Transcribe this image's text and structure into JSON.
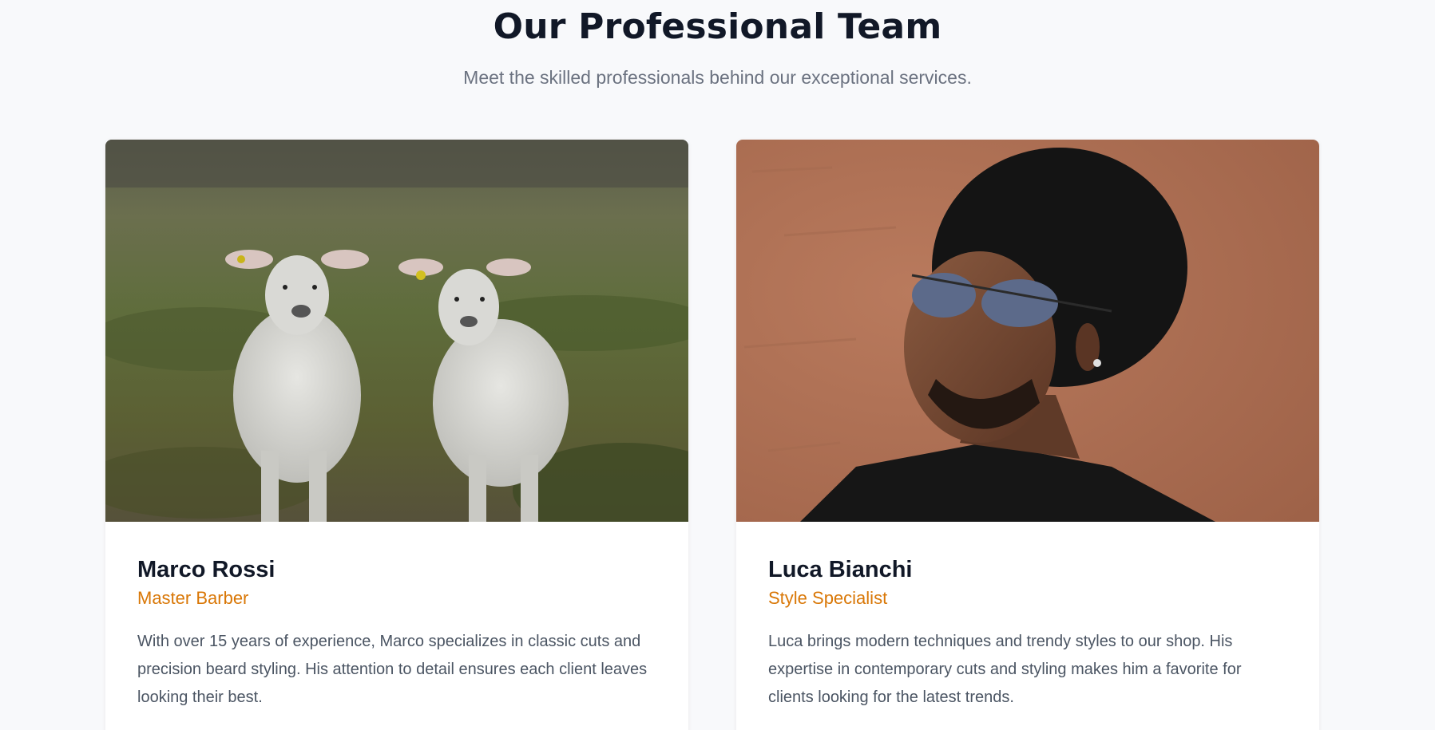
{
  "section": {
    "title": "Our Professional Team",
    "subtitle": "Meet the skilled professionals behind our exceptional services."
  },
  "team": [
    {
      "name": "Marco Rossi",
      "role": "Master Barber",
      "bio": "With over 15 years of experience, Marco specializes in classic cuts and precision beard styling. His attention to detail ensures each client leaves looking their best.",
      "photo_icon": "two-sheep-photo"
    },
    {
      "name": "Luca Bianchi",
      "role": "Style Specialist",
      "bio": "Luca brings modern techniques and trendy styles to our shop. His expertise in contemporary cuts and styling makes him a favorite for clients looking for the latest trends.",
      "photo_icon": "man-with-hat-photo"
    }
  ],
  "colors": {
    "accent": "#d97706",
    "heading": "#111827",
    "body_text": "#4b5563",
    "background": "#f8f9fb"
  }
}
